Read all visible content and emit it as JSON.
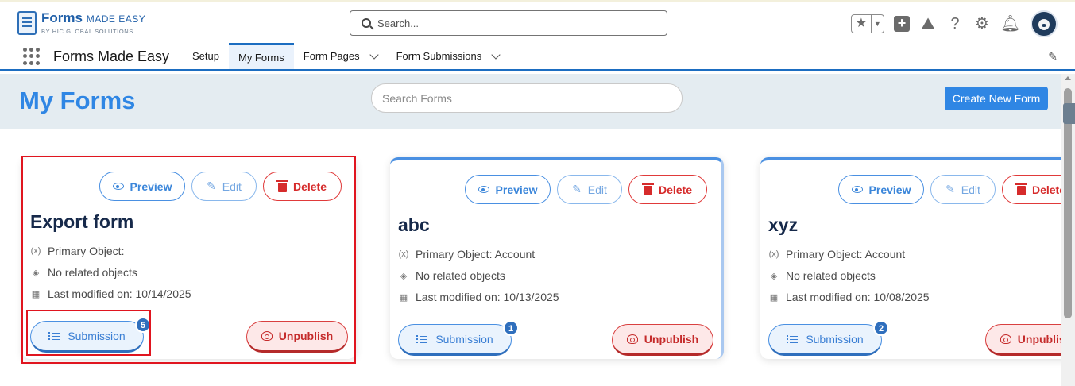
{
  "header": {
    "logo_main": "Forms",
    "logo_made": "MADE EASY",
    "logo_sub": "BY HIC GLOBAL SOLUTIONS",
    "search_placeholder": "Search..."
  },
  "nav": {
    "app_name": "Forms Made Easy",
    "tabs": [
      {
        "label": "Setup",
        "active": false,
        "dropdown": false
      },
      {
        "label": "My Forms",
        "active": true,
        "dropdown": false
      },
      {
        "label": "Form Pages",
        "active": false,
        "dropdown": true
      },
      {
        "label": "Form Submissions",
        "active": false,
        "dropdown": true
      }
    ]
  },
  "page": {
    "title": "My Forms",
    "search_placeholder": "Search Forms",
    "create_label": "Create New Form"
  },
  "card_labels": {
    "preview": "Preview",
    "edit": "Edit",
    "delete": "Delete",
    "submission": "Submission",
    "unpublish": "Unpublish"
  },
  "forms": [
    {
      "title": "Export form",
      "primary_object": "Primary Object:",
      "related": "No related objects",
      "modified": "Last modified on: 10/14/2025",
      "submissions": "5"
    },
    {
      "title": "abc",
      "primary_object": "Primary Object: Account",
      "related": "No related objects",
      "modified": "Last modified on: 10/13/2025",
      "submissions": "1"
    },
    {
      "title": "xyz",
      "primary_object": "Primary Object: Account",
      "related": "No related objects",
      "modified": "Last modified on: 10/08/2025",
      "submissions": "2"
    }
  ],
  "colors": {
    "brand": "#2f86e4",
    "nav_accent": "#1b6dc1",
    "danger": "#d62b2b",
    "highlight": "#e0151f"
  },
  "icons": [
    "search-icon",
    "star-icon",
    "plus-icon",
    "trailhead-icon",
    "help-icon",
    "gear-icon",
    "bell-icon",
    "waffle-icon",
    "pencil-icon",
    "eye-icon",
    "wand-icon",
    "trash-icon",
    "list-icon",
    "unpublish-icon"
  ]
}
